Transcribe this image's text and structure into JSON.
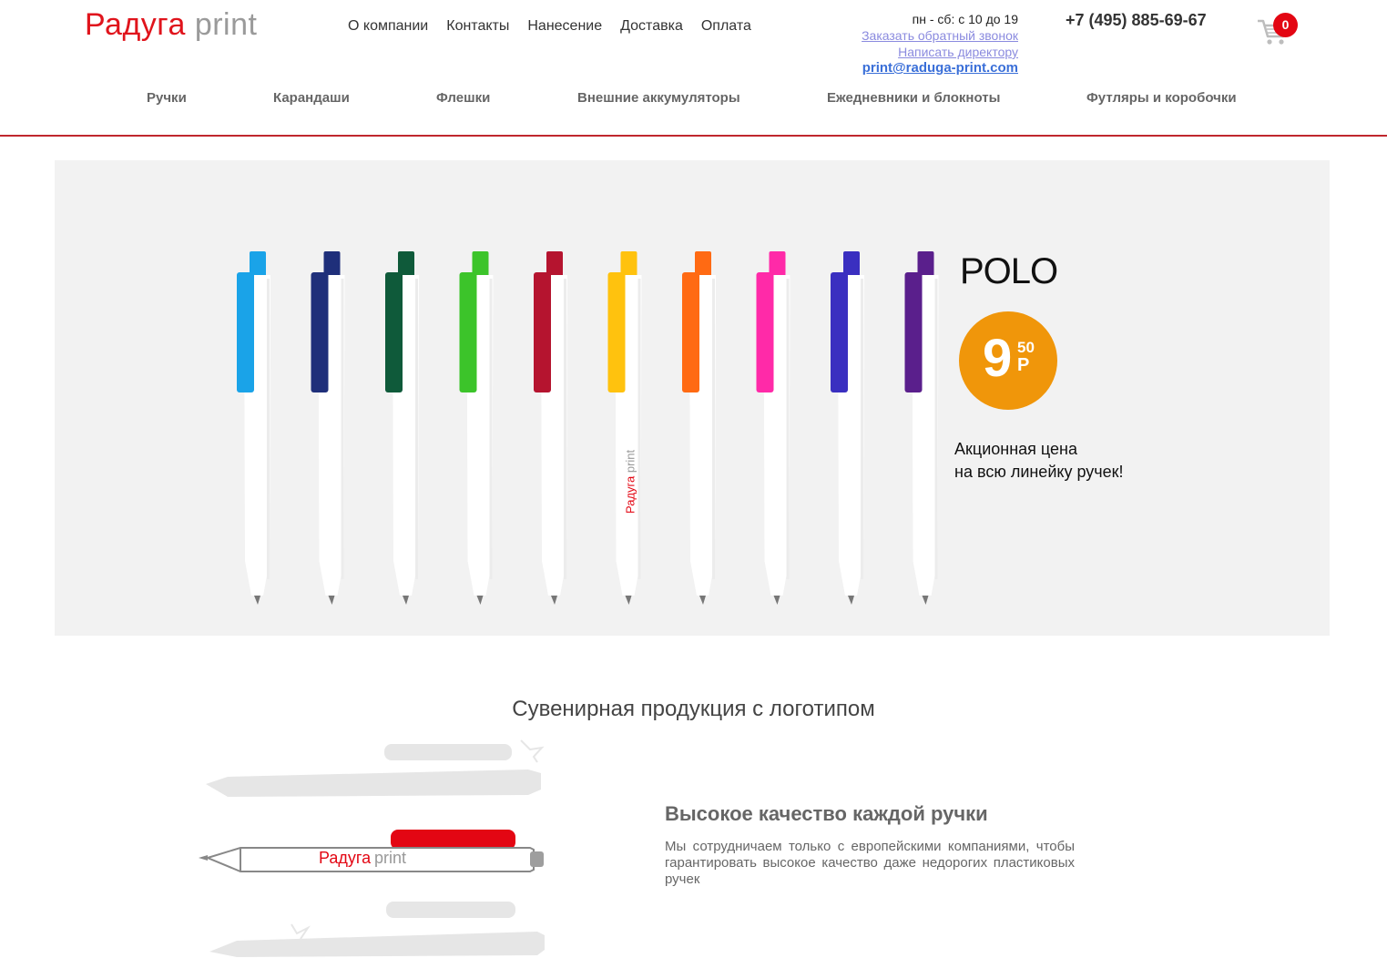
{
  "logo": {
    "part1": "Радуга",
    "part2": "print"
  },
  "topnav": [
    "О компании",
    "Контакты",
    "Нанесение",
    "Доставка",
    "Оплата"
  ],
  "contact": {
    "hours": "пн - сб: с 10 до 19",
    "callback": "Заказать обратный звонок",
    "director": "Написать директору",
    "email": "print@raduga-print.com"
  },
  "phone": "+7 (495) 885-69-67",
  "cart": {
    "icon": "cart-icon",
    "count": "0"
  },
  "categories": [
    "Ручки",
    "Карандаши",
    "Флешки",
    "Внешние аккумуляторы",
    "Ежедневники и блокноты",
    "Футляры и коробочки"
  ],
  "banner": {
    "product": "POLO",
    "price_main": "9",
    "price_cents": "50",
    "price_currency": "Р",
    "promo_line1": "Акционная цена",
    "promo_line2": "на всю линейку ручек!",
    "pen_print": "Радуга print",
    "pen_colors": [
      "#1aa3e8",
      "#1f2f7a",
      "#0f5a3a",
      "#3cc42a",
      "#b5142f",
      "#ffc20e",
      "#ff6a13",
      "#ff2aa8",
      "#3a2fc0",
      "#5a1f8c"
    ]
  },
  "section_title": "Сувенирная продукция с логотипом",
  "feature": {
    "title": "Высокое качество каждой ручки",
    "text": "Мы сотрудничаем только с европейскими компаниями, чтобы гарантировать высокое качество даже недорогих пластиковых ручек",
    "pen_logo_part1": "Радуга",
    "pen_logo_part2": "print"
  }
}
